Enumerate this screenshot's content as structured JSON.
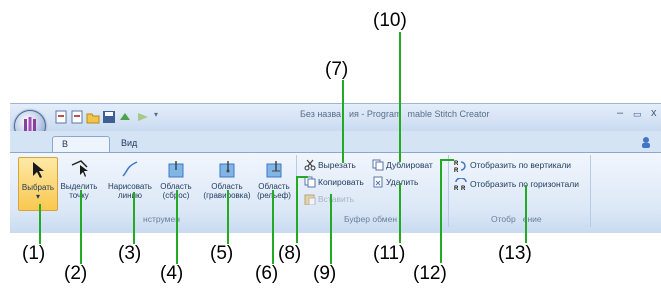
{
  "window": {
    "title": "Без названия - Programmable Stitch Creator",
    "title_left": "Без назва",
    "title_mid": "ия - Program",
    "title_right": "mable Stitch Creator",
    "minimize": "–",
    "maximize": "▭",
    "close": "x"
  },
  "tabs": [
    {
      "label": "В начало",
      "active": true
    },
    {
      "label": "Вид",
      "active": false
    }
  ],
  "groups": {
    "tools": {
      "label": "Инструменты",
      "label_shown": "нструмен",
      "buttons": [
        {
          "line1": "Выбрать",
          "line2": "▾"
        },
        {
          "line1": "Выделить",
          "line2": "точку"
        },
        {
          "line1": "Нарисовать",
          "line2": "линию"
        },
        {
          "line1": "Область",
          "line2": "(сброс)"
        },
        {
          "line1": "Область",
          "line2": "(гравировка)"
        },
        {
          "line1": "Область",
          "line2": "(рельеф)"
        }
      ]
    },
    "clipboard": {
      "label": "Буфер обмен",
      "label_shown": "Буфер обмен",
      "cut": "Вырезать",
      "copy": "Копировать",
      "paste": "Вставить",
      "duplicate": "Дублировать",
      "duplicate_shown": "Дублироват",
      "delete": "Удалить"
    },
    "display": {
      "label": "Отображение",
      "label_shown": "Отобр",
      "label_tail": "ение",
      "flip_vertical": "Отобразить по вертикали",
      "flip_horizontal": "Отобразить по горизонтали"
    }
  },
  "callouts": {
    "c1": "(1)",
    "c2": "(2)",
    "c3": "(3)",
    "c4": "(4)",
    "c5": "(5)",
    "c6": "(6)",
    "c7": "(7)",
    "c8": "(8)",
    "c9": "(9)",
    "c10": "(10)",
    "c11": "(11)",
    "c12": "(12)",
    "c13": "(13)"
  },
  "colors": {
    "callout_line": "#22aa22",
    "selected_button": "#f9c84f",
    "ribbon_bg": "#dce8f7"
  }
}
